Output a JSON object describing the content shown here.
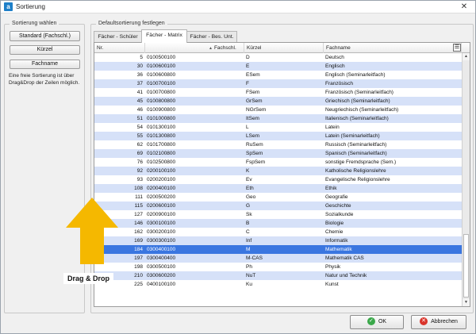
{
  "window": {
    "title": "Sortierung",
    "close_glyph": "✕",
    "app_icon_letter": "a"
  },
  "left_panel": {
    "legend": "Sortierung wählen",
    "buttons": [
      "Standard (Fachschl.)",
      "Kürzel",
      "Fachname"
    ],
    "help_text": "Eine freie Sortierung ist über Drag&Drop der Zeilen möglich."
  },
  "right_panel": {
    "legend": "Defaultsortierung festlegen"
  },
  "tabs": [
    "Fächer - Schüler",
    "Fächer - Matrix",
    "Fächer - Bes. Unt."
  ],
  "active_tab": 1,
  "table": {
    "columns": [
      "Nr.",
      "Fachschl.",
      "Kürzel",
      "Fachname"
    ],
    "sort_indicator": "▲",
    "selected_row": 22,
    "rows": [
      [
        "5",
        "0100500100",
        "D",
        "Deutsch"
      ],
      [
        "30",
        "0100600100",
        "E",
        "Englisch"
      ],
      [
        "36",
        "0100600800",
        "ESem",
        "Englisch (Seminarleitfach)"
      ],
      [
        "37",
        "0100700100",
        "F",
        "Französisch"
      ],
      [
        "41",
        "0100700800",
        "FSem",
        "Französisch (Seminarleitfach)"
      ],
      [
        "45",
        "0100800800",
        "GrSem",
        "Griechisch (Seminarleitfach)"
      ],
      [
        "46",
        "0100900800",
        "NGrSem",
        "Neugriechisch (Seminarleitfach)"
      ],
      [
        "51",
        "0101000800",
        "ItSem",
        "Italienisch (Seminarleitfach)"
      ],
      [
        "54",
        "0101300100",
        "L",
        "Latein"
      ],
      [
        "55",
        "0101300800",
        "LSem",
        "Latein (Seminarleitfach)"
      ],
      [
        "62",
        "0101700800",
        "RuSem",
        "Russisch (Seminarleitfach)"
      ],
      [
        "69",
        "0102100800",
        "SpSem",
        "Spanisch (Seminarleitfach)"
      ],
      [
        "76",
        "0102500800",
        "FspSem",
        "sonstige Fremdsprache (Sem.)"
      ],
      [
        "92",
        "0200100100",
        "K",
        "Katholische Religionslehre"
      ],
      [
        "93",
        "0200200100",
        "Ev",
        "Evangelische Religionslehre"
      ],
      [
        "108",
        "0200400100",
        "Eth",
        "Ethik"
      ],
      [
        "111",
        "0200500200",
        "Geo",
        "Geografie"
      ],
      [
        "115",
        "0200600100",
        "G",
        "Geschichte"
      ],
      [
        "127",
        "0200900100",
        "Sk",
        "Sozialkunde"
      ],
      [
        "146",
        "0300100100",
        "B",
        "Biologie"
      ],
      [
        "162",
        "0300200100",
        "C",
        "Chemie"
      ],
      [
        "169",
        "0300300100",
        "Inf",
        "Informatik"
      ],
      [
        "184",
        "0300400100",
        "M",
        "Mathematik"
      ],
      [
        "197",
        "0300400400",
        "M-CAS",
        "Mathematik CAS"
      ],
      [
        "198",
        "0300500100",
        "Ph",
        "Physik"
      ],
      [
        "210",
        "0300600200",
        "NuT",
        "Natur und Technik"
      ],
      [
        "225",
        "0400100100",
        "Ku",
        "Kunst"
      ]
    ]
  },
  "overlay": {
    "label": "Drag & Drop",
    "arrow_color": "#f5b800"
  },
  "footer": {
    "ok_label": "OK",
    "cancel_label": "Abbrechen",
    "ok_color": "#3aa84a",
    "cancel_color": "#d9342b"
  }
}
